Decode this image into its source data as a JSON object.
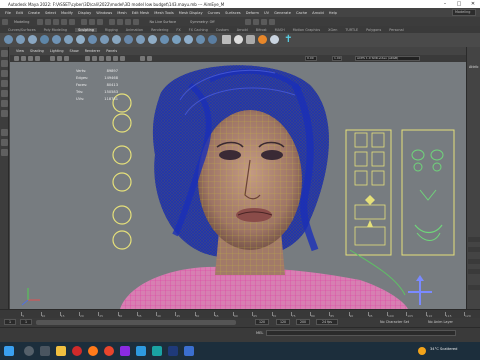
{
  "window": {
    "title": "Autodesk Maya 2022: F:\\ASSET\\cyber\\3D\\cali\\2022\\model\\3D model low budget\\143.mayu.mb  ---  AimEye_M",
    "controls": [
      "–",
      "□",
      "✕"
    ]
  },
  "menubar": {
    "items": [
      "File",
      "Edit",
      "Create",
      "Select",
      "Modify",
      "Display",
      "Windows",
      "Mesh",
      "Edit Mesh",
      "Mesh Tools",
      "Mesh Display",
      "Curves",
      "Surfaces",
      "Deform",
      "UV",
      "Generate",
      "Cache",
      "Arnold",
      "Help"
    ],
    "workspace": "Modeling"
  },
  "statusline": {
    "mode": "Modeling",
    "no_live_surface": "No Live Surface",
    "symmetry": "Symmetry: Off"
  },
  "shelf": {
    "tabs": [
      "Curves/Surfaces",
      "Poly Modeling",
      "Sculpting",
      "Rigging",
      "Animation",
      "Rendering",
      "FX",
      "FX Caching",
      "Custom",
      "Arnold",
      "Bifrost",
      "MASH",
      "Motion Graphics",
      "XGen",
      "TURTLE",
      "Polygons",
      "Personal"
    ],
    "active_tab": "Sculpting"
  },
  "panel": {
    "menu": [
      "View",
      "Shading",
      "Lighting",
      "Show",
      "Renderer",
      "Panels"
    ],
    "exposure": "0.00",
    "gamma": "1.00",
    "color_space": "ACES 1.0 SDR-video (sRGB)"
  },
  "hud": {
    "rows": [
      {
        "label": "Verts:",
        "value": "89897"
      },
      {
        "label": "Edges:",
        "value": "149468"
      },
      {
        "label": "Faces:",
        "value": "80413"
      },
      {
        "label": "Tris:",
        "value": "150583"
      },
      {
        "label": "UVs:",
        "value": "118781"
      }
    ]
  },
  "right_panel": {
    "tab": "Attrib"
  },
  "timeline": {
    "ticks": [
      "5",
      "10",
      "15",
      "20",
      "25",
      "30",
      "35",
      "40",
      "45",
      "50",
      "55",
      "60",
      "65",
      "70",
      "75",
      "80",
      "85",
      "90",
      "95",
      "100",
      "105",
      "110",
      "115",
      "120"
    ]
  },
  "range": {
    "start": "1",
    "start2": "1",
    "end": "120",
    "end2": "120",
    "end3": "200",
    "fps": "24 fps",
    "char_set": "No Character Set",
    "anim_layer": "No Anim Layer"
  },
  "cmdline": {
    "label": "MEL"
  },
  "taskbar": {
    "weather": "34°C Scattered",
    "colors": {
      "bg": "#1c2e3c",
      "accent": "#2e7bd6"
    }
  },
  "colors": {
    "wire_blue": "#1a2fb8",
    "wire_yellow": "#c9c235",
    "control_yellow": "#e5e07a",
    "viewport_bg": "#777c80"
  }
}
